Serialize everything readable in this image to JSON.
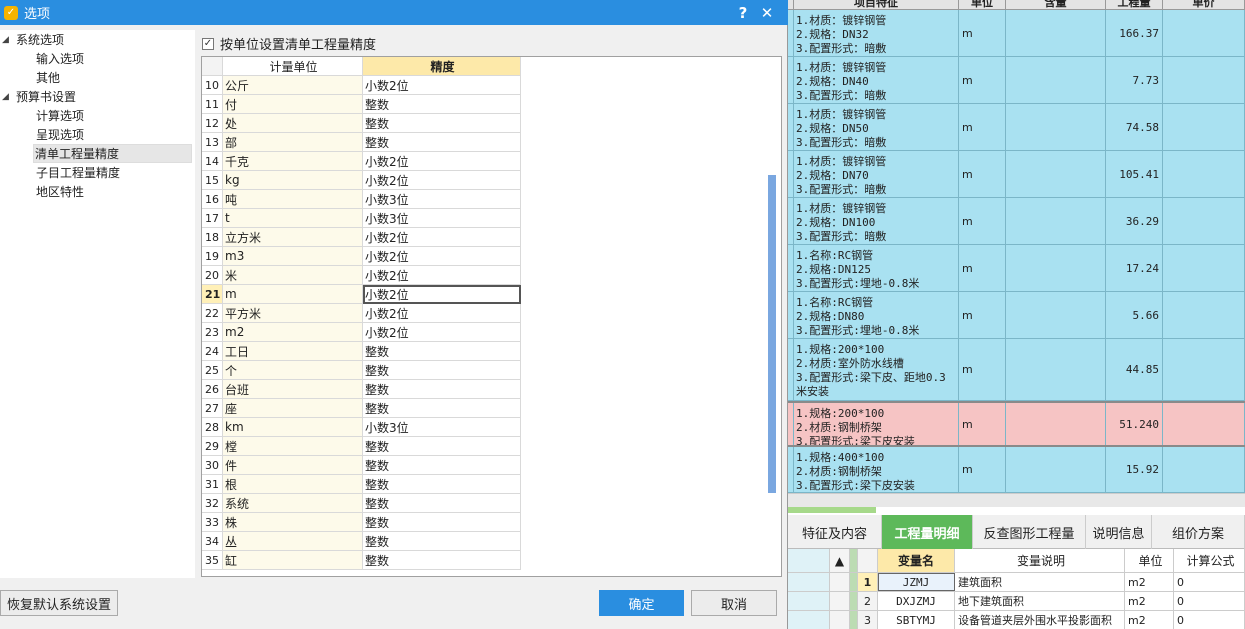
{
  "dialog": {
    "title": "选项",
    "help_glyph": "?",
    "close_glyph": "✕",
    "icon_glyph": "✓",
    "tree": [
      {
        "label": "系统选项",
        "level": 0,
        "expander": "◢"
      },
      {
        "label": "输入选项",
        "level": 1
      },
      {
        "label": "其他",
        "level": 1
      },
      {
        "label": "预算书设置",
        "level": 0,
        "expander": "◢"
      },
      {
        "label": "计算选项",
        "level": 1
      },
      {
        "label": "呈现选项",
        "level": 1
      },
      {
        "label": "清单工程量精度",
        "level": 1,
        "selected": true
      },
      {
        "label": "子目工程量精度",
        "level": 1
      },
      {
        "label": "地区特性",
        "level": 1
      }
    ],
    "checkbox_label": "按单位设置清单工程量精度",
    "checkbox_mark": "✓",
    "grid": {
      "headers": {
        "unit": "计量单位",
        "precision": "精度"
      },
      "rows": [
        {
          "idx": "10",
          "unit": "公斤",
          "precision": "小数2位"
        },
        {
          "idx": "11",
          "unit": "付",
          "precision": "整数"
        },
        {
          "idx": "12",
          "unit": "处",
          "precision": "整数"
        },
        {
          "idx": "13",
          "unit": "部",
          "precision": "整数"
        },
        {
          "idx": "14",
          "unit": "千克",
          "precision": "小数2位"
        },
        {
          "idx": "15",
          "unit": "kg",
          "precision": "小数2位"
        },
        {
          "idx": "16",
          "unit": "吨",
          "precision": "小数3位"
        },
        {
          "idx": "17",
          "unit": "t",
          "precision": "小数3位"
        },
        {
          "idx": "18",
          "unit": "立方米",
          "precision": "小数2位"
        },
        {
          "idx": "19",
          "unit": "m3",
          "precision": "小数2位"
        },
        {
          "idx": "20",
          "unit": "米",
          "precision": "小数2位"
        },
        {
          "idx": "21",
          "unit": "m",
          "precision": "小数2位",
          "selected": true
        },
        {
          "idx": "22",
          "unit": "平方米",
          "precision": "小数2位"
        },
        {
          "idx": "23",
          "unit": "m2",
          "precision": "小数2位"
        },
        {
          "idx": "24",
          "unit": "工日",
          "precision": "整数"
        },
        {
          "idx": "25",
          "unit": "个",
          "precision": "整数"
        },
        {
          "idx": "26",
          "unit": "台班",
          "precision": "整数"
        },
        {
          "idx": "27",
          "unit": "座",
          "precision": "整数"
        },
        {
          "idx": "28",
          "unit": "km",
          "precision": "小数3位"
        },
        {
          "idx": "29",
          "unit": "樘",
          "precision": "整数"
        },
        {
          "idx": "30",
          "unit": "件",
          "precision": "整数"
        },
        {
          "idx": "31",
          "unit": "根",
          "precision": "整数"
        },
        {
          "idx": "32",
          "unit": "系统",
          "precision": "整数"
        },
        {
          "idx": "33",
          "unit": "株",
          "precision": "整数"
        },
        {
          "idx": "34",
          "unit": "丛",
          "precision": "整数"
        },
        {
          "idx": "35",
          "unit": "缸",
          "precision": "整数"
        }
      ]
    },
    "buttons": {
      "reset": "恢复默认系统设置",
      "ok": "确定",
      "cancel": "取消"
    }
  },
  "right_panel": {
    "headers": [
      "项目特征",
      "单位",
      "含量",
      "工程量",
      "单价"
    ],
    "rows": [
      {
        "lines": [
          "1.材质：镀锌钢管",
          "2.规格：DN32",
          "3.配置形式：暗敷"
        ],
        "unit": "m",
        "qty": "166.37"
      },
      {
        "lines": [
          "1.材质：镀锌钢管",
          "2.规格：DN40",
          "3.配置形式：暗敷"
        ],
        "unit": "m",
        "qty": "7.73"
      },
      {
        "lines": [
          "1.材质：镀锌钢管",
          "2.规格：DN50",
          "3.配置形式：暗敷"
        ],
        "unit": "m",
        "qty": "74.58"
      },
      {
        "lines": [
          "1.材质：镀锌钢管",
          "2.规格：DN70",
          "3.配置形式：暗敷"
        ],
        "unit": "m",
        "qty": "105.41"
      },
      {
        "lines": [
          "1.材质：镀锌钢管",
          "2.规格：DN100",
          "3.配置形式：暗敷"
        ],
        "unit": "m",
        "qty": "36.29"
      },
      {
        "lines": [
          "1.名称:RC钢管",
          "2.规格:DN125",
          "3.配置形式:埋地-0.8米"
        ],
        "unit": "m",
        "qty": "17.24"
      },
      {
        "lines": [
          "1.名称:RC钢管",
          "2.规格:DN80",
          "3.配置形式:埋地-0.8米"
        ],
        "unit": "m",
        "qty": "5.66"
      },
      {
        "lines": [
          "1.规格:200*100",
          "2.材质:室外防水线槽",
          "3.配置形式:梁下皮、距地0.3",
          "米安装"
        ],
        "unit": "m",
        "qty": "44.85"
      },
      {
        "lines": [
          "1.规格:200*100",
          "2.材质:钢制桥架",
          "3.配置形式:梁下皮安装"
        ],
        "unit": "m",
        "qty": "51.240",
        "selected": true
      },
      {
        "lines": [
          "1.规格:400*100",
          "2.材质:钢制桥架",
          "3.配置形式:梁下皮安装"
        ],
        "unit": "m",
        "qty": "15.92"
      }
    ],
    "tabs": [
      "特征及内容",
      "工程量明细",
      "反查图形工程量",
      "说明信息",
      "组价方案"
    ],
    "active_tab": 1,
    "var_table": {
      "headers": {
        "name": "变量名",
        "desc": "变量说明",
        "unit": "单位",
        "formula": "计算公式"
      },
      "rows": [
        {
          "idx": "1",
          "name": "JZMJ",
          "desc": "建筑面积",
          "unit": "m2",
          "formula": "0"
        },
        {
          "idx": "2",
          "name": "DXJZMJ",
          "desc": "地下建筑面积",
          "unit": "m2",
          "formula": "0"
        },
        {
          "idx": "3",
          "name": "SBTYMJ",
          "desc": "设备管道夹层外围水平投影面积",
          "unit": "m2",
          "formula": "0"
        }
      ]
    }
  }
}
